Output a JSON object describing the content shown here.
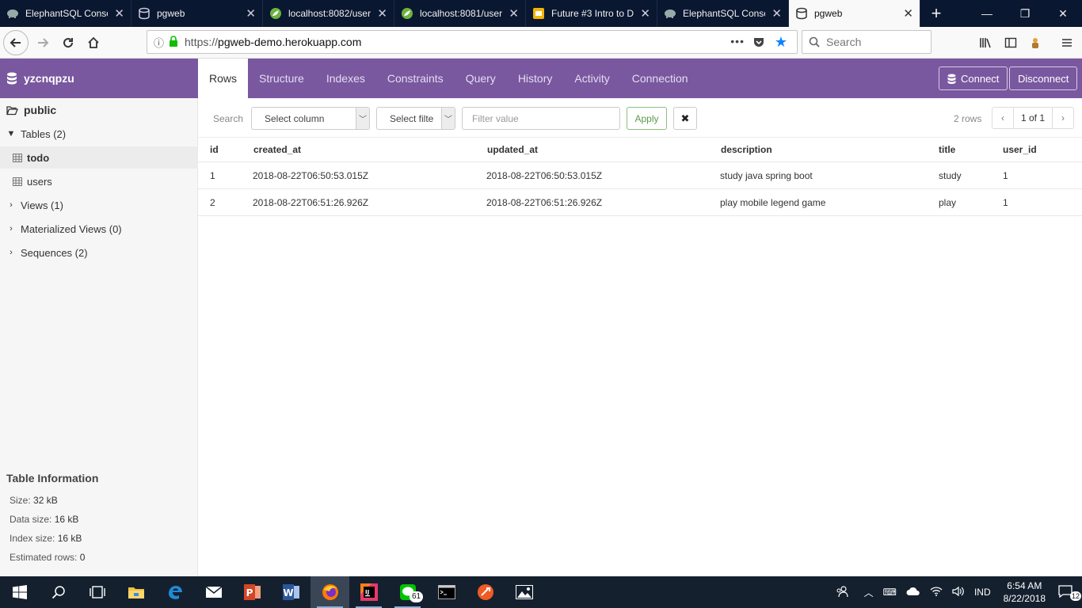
{
  "browser": {
    "tabs": [
      {
        "title": "ElephantSQL Conso",
        "icon": "elephant-icon",
        "active": false
      },
      {
        "title": "pgweb",
        "icon": "database-icon",
        "active": false
      },
      {
        "title": "localhost:8082/user",
        "icon": "spring-leaf-icon",
        "active": false
      },
      {
        "title": "localhost:8081/user",
        "icon": "spring-leaf-icon",
        "active": false
      },
      {
        "title": "Future #3 Intro to D",
        "icon": "slides-icon",
        "active": false
      },
      {
        "title": "ElephantSQL Conso",
        "icon": "elephant-icon",
        "active": false
      },
      {
        "title": "pgweb",
        "icon": "database-icon",
        "active": true
      }
    ],
    "url_scheme": "https://",
    "url_host": "pgweb-demo.herokuapp.com",
    "search_placeholder": "Search",
    "colors": {
      "tabbar_bg": "#0a1730",
      "bookmark_star": "#0a84ff"
    }
  },
  "app": {
    "database_name": "yzcnqpzu",
    "accent_color": "#79589f",
    "nav_tabs": [
      {
        "label": "Rows",
        "active": true
      },
      {
        "label": "Structure",
        "active": false
      },
      {
        "label": "Indexes",
        "active": false
      },
      {
        "label": "Constraints",
        "active": false
      },
      {
        "label": "Query",
        "active": false
      },
      {
        "label": "History",
        "active": false
      },
      {
        "label": "Activity",
        "active": false
      },
      {
        "label": "Connection",
        "active": false
      }
    ],
    "connect_label": "Connect",
    "disconnect_label": "Disconnect"
  },
  "sidebar": {
    "schema": "public",
    "tables_label": "Tables (2)",
    "tables": [
      {
        "name": "todo",
        "selected": true
      },
      {
        "name": "users",
        "selected": false
      }
    ],
    "views_label": "Views (1)",
    "materialized_views_label": "Materialized Views (0)",
    "sequences_label": "Sequences (2)",
    "table_info": {
      "title": "Table Information",
      "size_label": "Size:",
      "size": "32 kB",
      "data_size_label": "Data size:",
      "data_size": "16 kB",
      "index_size_label": "Index size:",
      "index_size": "16 kB",
      "estimated_rows_label": "Estimated rows:",
      "estimated_rows": "0"
    }
  },
  "filter": {
    "search_label": "Search",
    "column_select": "Select column",
    "filter_select": "Select filte",
    "value_placeholder": "Filter value",
    "apply_label": "Apply",
    "clear_symbol": "✖",
    "rows_count": "2 rows",
    "page": "1 of 1",
    "prev_symbol": "‹",
    "next_symbol": "›"
  },
  "table": {
    "columns": [
      "id",
      "created_at",
      "updated_at",
      "description",
      "title",
      "user_id"
    ],
    "rows": [
      [
        "1",
        "2018-08-22T06:50:53.015Z",
        "2018-08-22T06:50:53.015Z",
        "study java spring boot",
        "study",
        "1"
      ],
      [
        "2",
        "2018-08-22T06:51:26.926Z",
        "2018-08-22T06:51:26.926Z",
        "play mobile legend game",
        "play",
        "1"
      ]
    ]
  },
  "taskbar": {
    "apps": [
      "windows-start-icon",
      "search-icon",
      "task-view-icon",
      "file-explorer-icon",
      "edge-icon",
      "mail-icon",
      "powerpoint-icon",
      "word-icon",
      "firefox-icon",
      "intellij-icon",
      "line-icon",
      "terminal-icon",
      "postman-icon",
      "photos-icon"
    ],
    "line_badge": "61",
    "language": "IND",
    "time": "6:54 AM",
    "date": "8/22/2018",
    "notification_count": "12"
  }
}
